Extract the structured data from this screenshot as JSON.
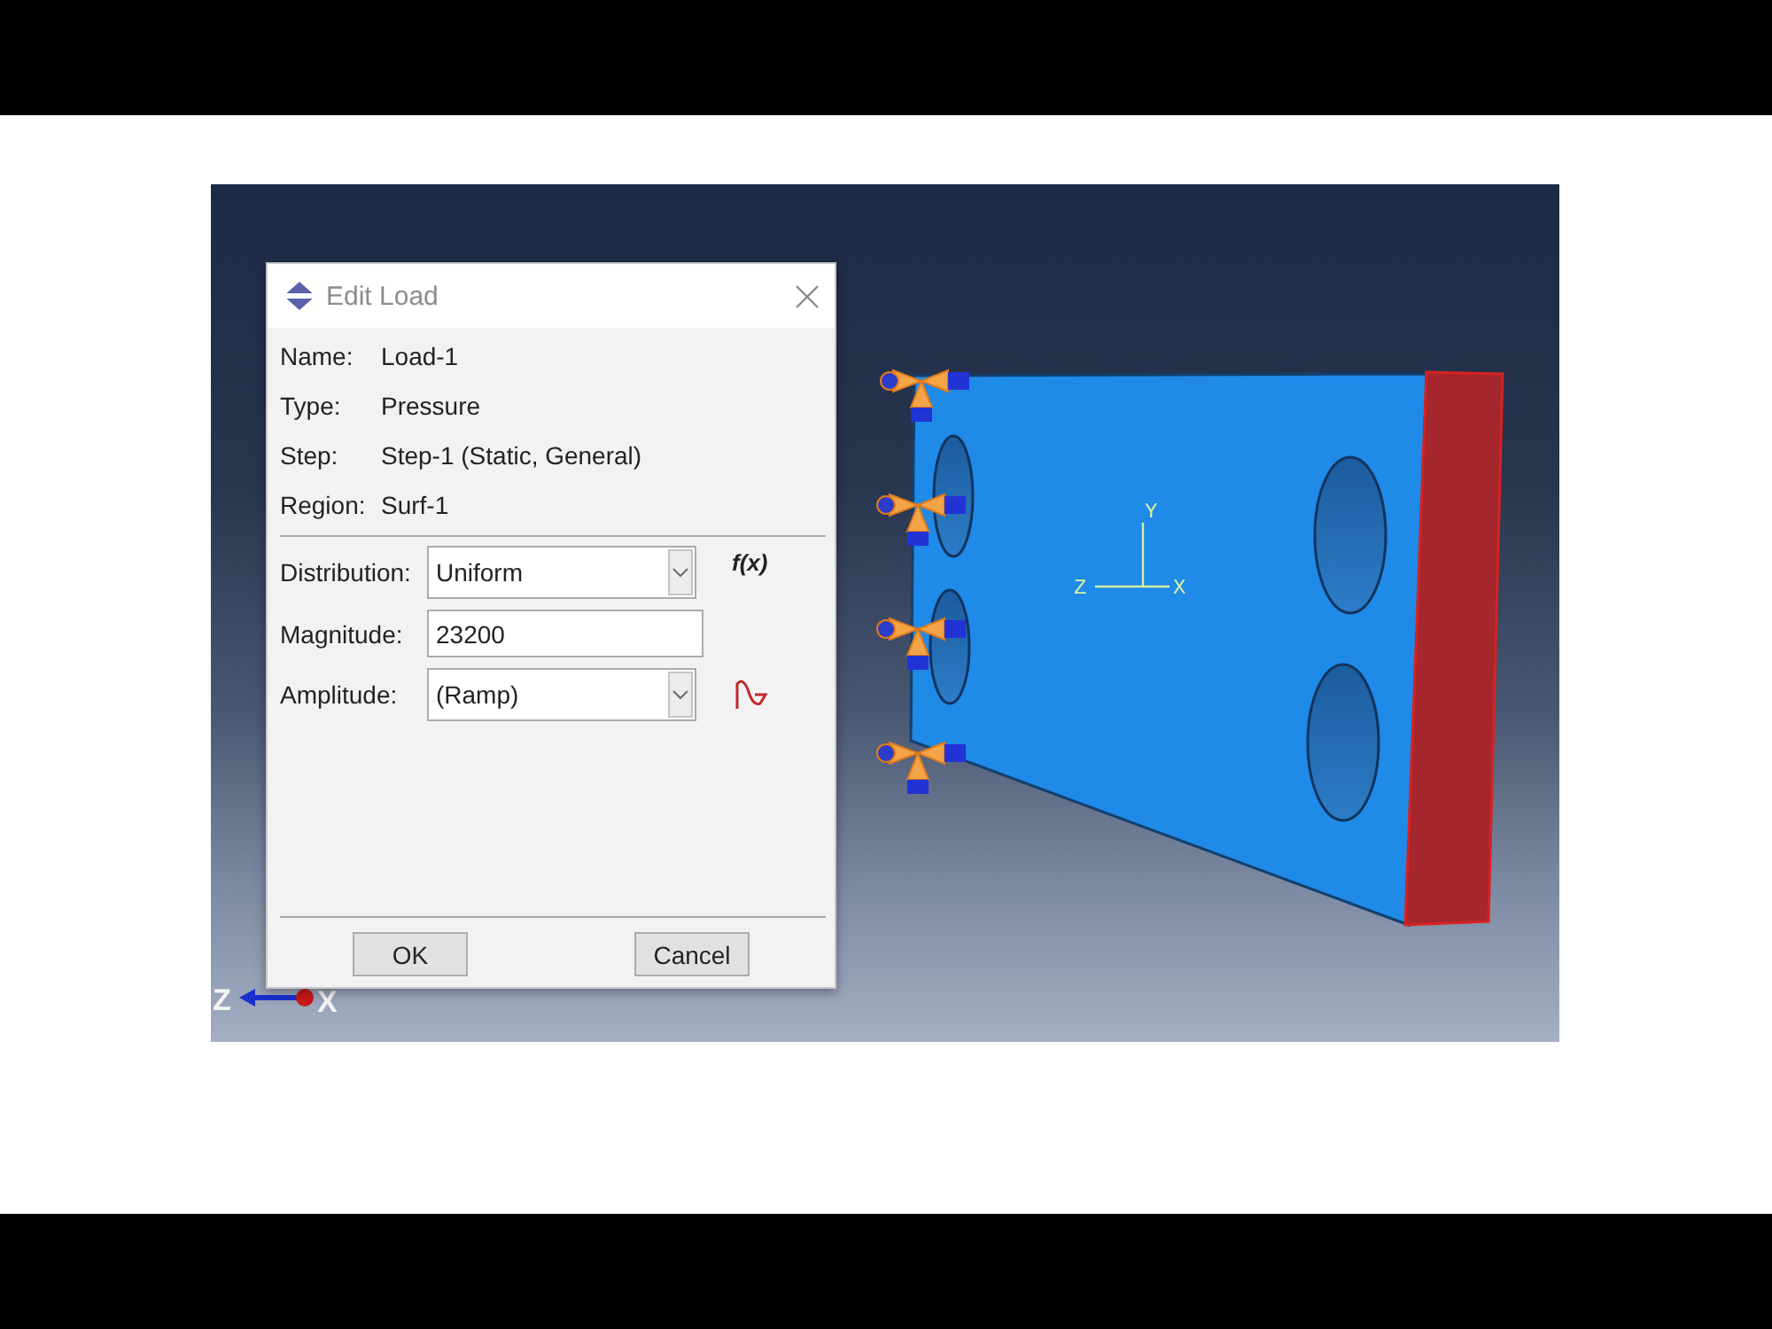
{
  "dialog": {
    "title": "Edit Load",
    "info": [
      {
        "label": "Name:",
        "value": "Load-1"
      },
      {
        "label": "Type:",
        "value": "Pressure"
      },
      {
        "label": "Step:",
        "value": "Step-1 (Static, General)"
      },
      {
        "label": "Region:",
        "value": "Surf-1"
      }
    ],
    "fields": [
      {
        "kind": "dropdown",
        "label": "Distribution:",
        "value": "Uniform",
        "side": {
          "kind": "text",
          "label": "f(x)"
        }
      },
      {
        "kind": "text",
        "label": "Magnitude:",
        "value": "23200"
      },
      {
        "kind": "dropdown",
        "label": "Amplitude:",
        "value": "(Ramp)",
        "side": {
          "kind": "icon"
        }
      }
    ],
    "buttons": [
      "OK",
      "Cancel"
    ]
  },
  "viewport": {
    "model_axes": [
      "Y",
      "Z",
      "X"
    ],
    "view_axes": [
      "Z",
      "X"
    ]
  }
}
